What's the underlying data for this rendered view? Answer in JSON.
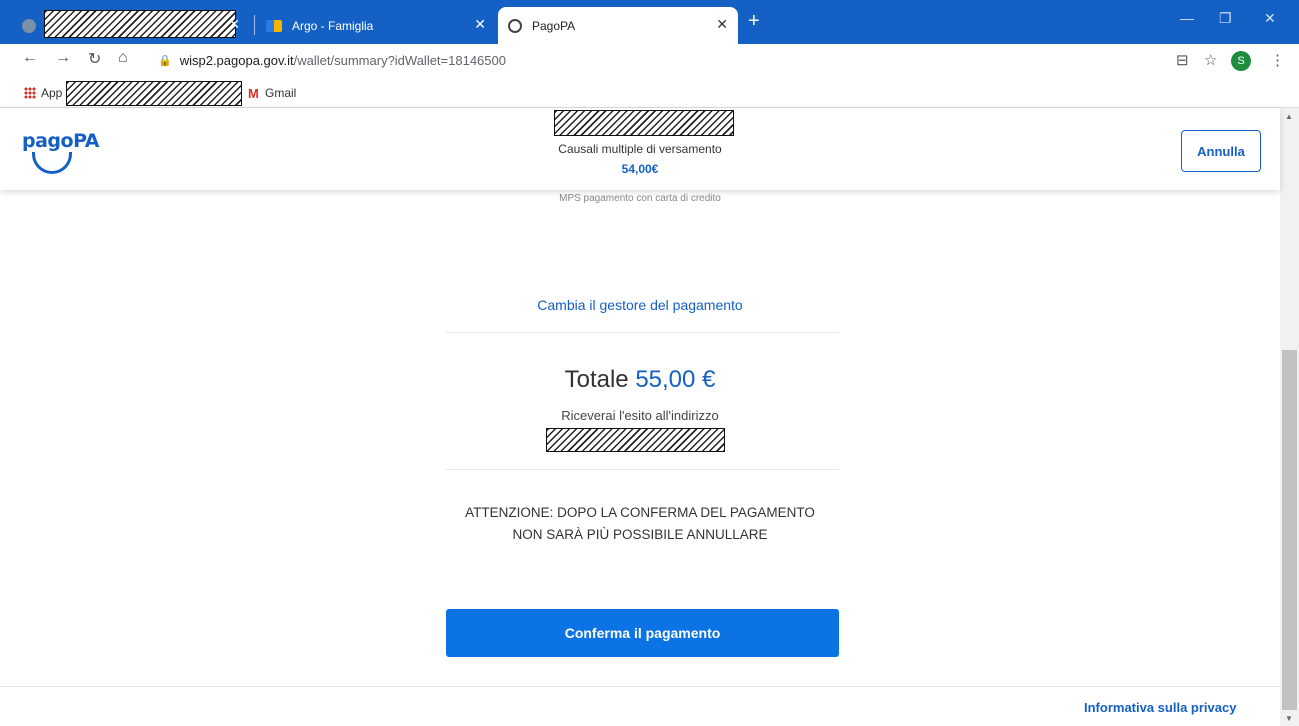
{
  "browser": {
    "tabs": [
      {
        "label": "",
        "close": "✕"
      },
      {
        "label": "Argo - Famiglia",
        "close": "✕"
      },
      {
        "label": "PagoPA",
        "close": "✕"
      }
    ],
    "new_tab": "+",
    "window": {
      "minimize": "—",
      "restore": "❐",
      "close": "✕"
    },
    "nav": {
      "back": "←",
      "forward": "→",
      "reload": "↻",
      "home": "⌂"
    },
    "address": {
      "lock": "🔒",
      "host": "wisp2.pagopa.gov.it",
      "path": "/wallet/summary?idWallet=18146500"
    },
    "toolbar_icons": {
      "tab_search": "⊟",
      "star": "☆",
      "profile": "S",
      "menu": "⋮"
    },
    "bookmarks": {
      "apps": "App",
      "gmail_icon": "M",
      "gmail": "Gmail"
    }
  },
  "header": {
    "logo": "pagoPA",
    "reason": "Causali multiple di versamento",
    "amount": "54,00€",
    "cancel_label": "Annulla"
  },
  "main": {
    "provider": "MPS pagamento con carta di credito",
    "change_link": "Cambia il gestore del pagamento",
    "total_label": "Totale",
    "total_value": "55,00 €",
    "notice": "Riceverai l'esito all'indirizzo",
    "warning_line1": "ATTENZIONE: DOPO LA CONFERMA DEL PAGAMENTO",
    "warning_line2": "NON SARÀ PIÙ POSSIBILE ANNULLARE",
    "confirm_label": "Conferma il pagamento",
    "privacy_link": "Informativa sulla privacy"
  },
  "scrollbar": {
    "up": "▲",
    "down": "▼"
  },
  "colors": {
    "brand": "#1460c4",
    "button": "#0b73e3"
  }
}
